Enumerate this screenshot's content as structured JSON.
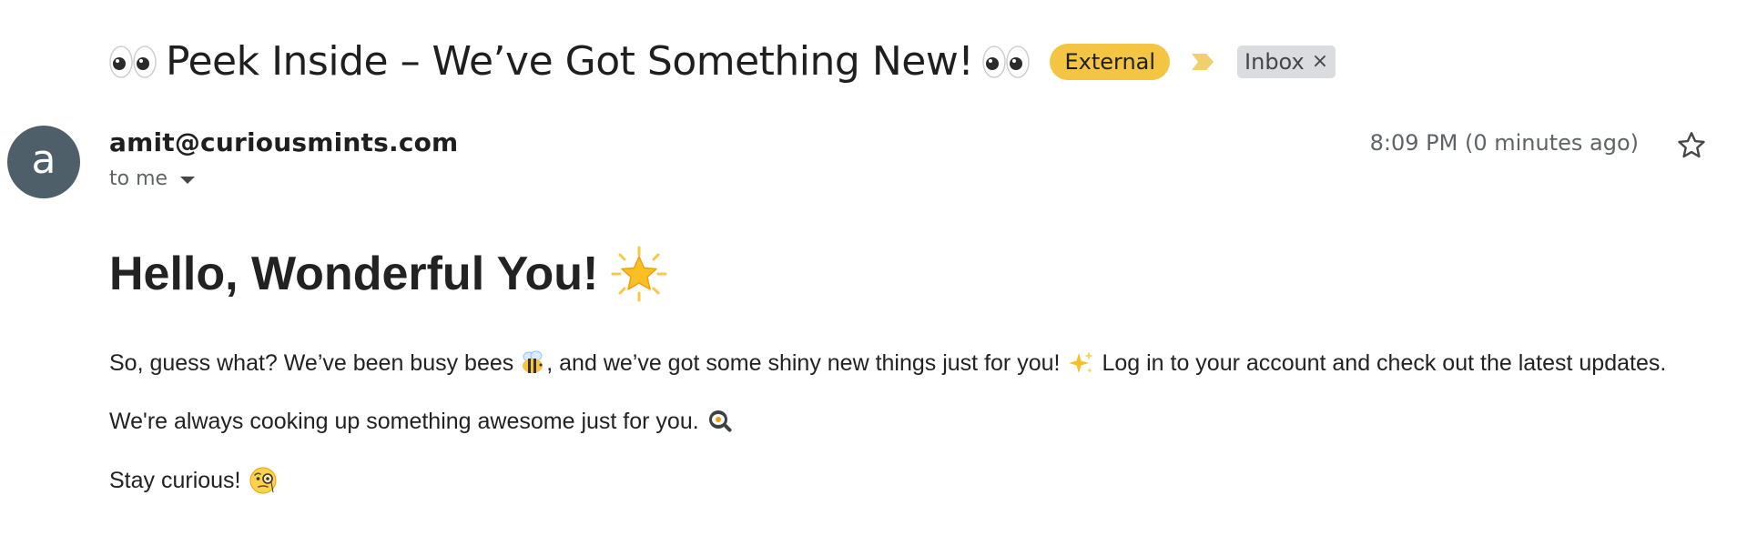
{
  "email": {
    "subject": {
      "prefix_emoji": "eyes-emoji",
      "text": "Peek Inside – We’ve Got Something New!",
      "suffix_emoji": "eyes-emoji"
    },
    "labels": {
      "external": "External",
      "inbox": "Inbox",
      "inbox_remove": "×"
    },
    "sender": {
      "avatar_letter": "a",
      "email": "amit@curiousmints.com",
      "recipient": "to me",
      "timestamp": "8:09 PM (0 minutes ago)"
    },
    "body": {
      "greeting": "Hello, Wonderful You!",
      "greeting_emoji": "glowing-star-emoji",
      "para1_a": "So, guess what? We’ve been busy bees",
      "para1_b": ", and we’ve got some shiny new things just for you!",
      "para1_c": "Log in to your account and check out the latest updates.",
      "para2": "We're always cooking up something awesome just for you.",
      "para3": "Stay curious!"
    }
  },
  "icons": {
    "star": "star-outline-icon",
    "importance": "importance-marker-icon",
    "chevron": "chevron-down-icon",
    "bee": "honeybee-emoji",
    "sparkles": "sparkles-emoji",
    "cooking": "cooking-pan-emoji",
    "monocle": "face-with-monocle-emoji"
  },
  "colors": {
    "external_label": "#f4c542",
    "inbox_label": "#dadce0",
    "avatar_bg": "#4f5f6a",
    "importance_marker": "#f1cf6e"
  }
}
